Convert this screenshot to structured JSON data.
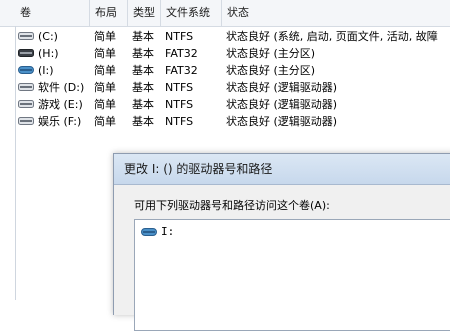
{
  "table": {
    "columns": [
      "卷",
      "布局",
      "类型",
      "文件系统",
      "状态"
    ],
    "rows": [
      {
        "icon": "system-drive-icon",
        "name": "(C:)",
        "layout": "简单",
        "type": "基本",
        "fs": "NTFS",
        "status": "状态良好 (系统, 启动, 页面文件, 活动, 故障"
      },
      {
        "icon": "removable-drive-icon",
        "name": "(H:)",
        "layout": "简单",
        "type": "基本",
        "fs": "FAT32",
        "status": "状态良好 (主分区)"
      },
      {
        "icon": "removable-drive-icon",
        "name": "(I:)",
        "layout": "简单",
        "type": "基本",
        "fs": "FAT32",
        "status": "状态良好 (主分区)"
      },
      {
        "icon": "hard-drive-icon",
        "name": "软件 (D:)",
        "layout": "简单",
        "type": "基本",
        "fs": "NTFS",
        "status": "状态良好 (逻辑驱动器)"
      },
      {
        "icon": "hard-drive-icon",
        "name": "游戏 (E:)",
        "layout": "简单",
        "type": "基本",
        "fs": "NTFS",
        "status": "状态良好 (逻辑驱动器)"
      },
      {
        "icon": "hard-drive-icon",
        "name": "娱乐 (F:)",
        "layout": "简单",
        "type": "基本",
        "fs": "NTFS",
        "status": "状态良好 (逻辑驱动器)"
      }
    ]
  },
  "dialog": {
    "title": "更改 I: () 的驱动器号和路径",
    "label": "可用下列驱动器号和路径访问这个卷(A):",
    "items": [
      {
        "icon": "drive-icon",
        "label": "I:"
      }
    ]
  },
  "colors": {
    "header_bg": "#f4f6f9",
    "dialog_title_bg": "#c7d8ec",
    "drive_blue": "#4a90c8"
  }
}
